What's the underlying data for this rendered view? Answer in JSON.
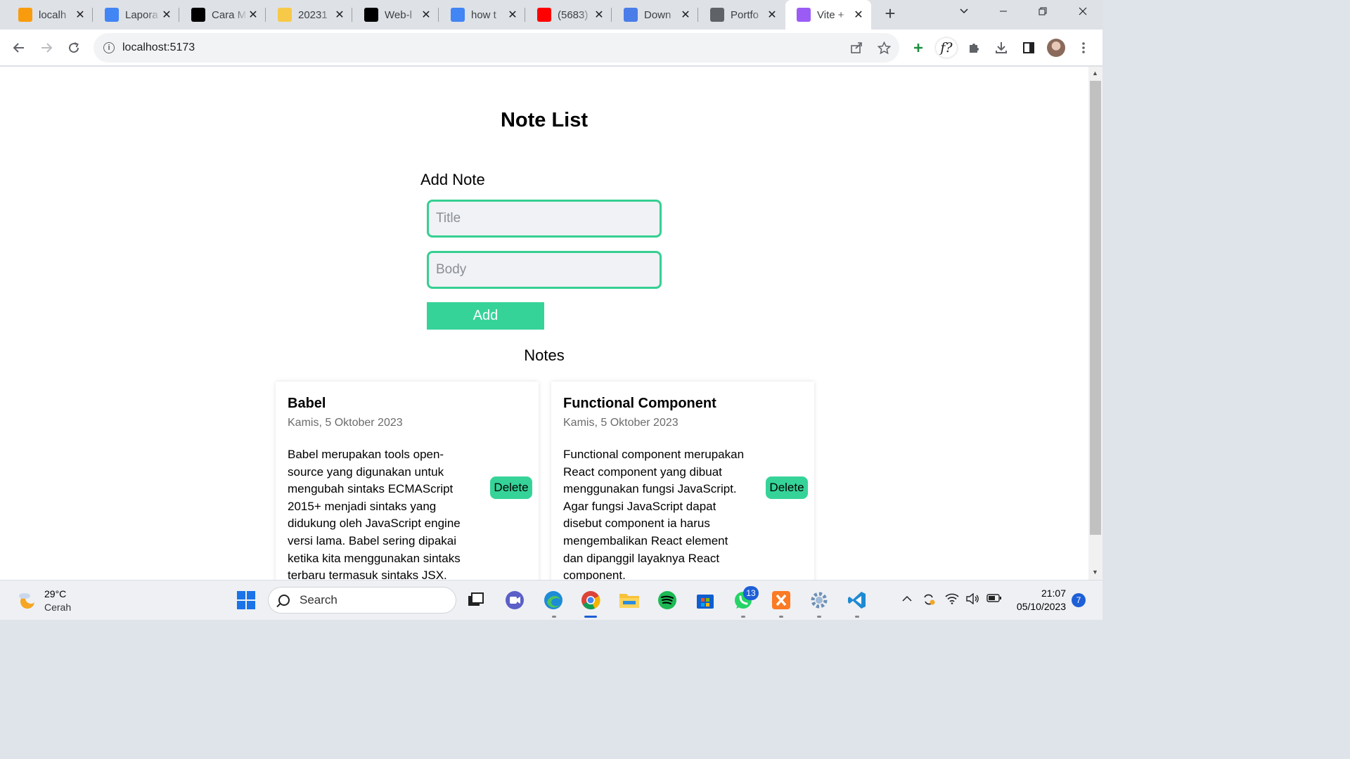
{
  "browser": {
    "tabs": [
      {
        "title": "localh",
        "icon": "phpmyadmin-icon",
        "color": "#f89c0e"
      },
      {
        "title": "Lapora",
        "icon": "google-docs-icon",
        "color": "#4285f4"
      },
      {
        "title": "Cara M",
        "icon": "arrow-logo-icon",
        "color": "#000000"
      },
      {
        "title": "20231",
        "icon": "bulb-icon",
        "color": "#f7c948"
      },
      {
        "title": "Web-l",
        "icon": "github-icon",
        "color": "#000000"
      },
      {
        "title": "how t",
        "icon": "google-icon",
        "color": "#4285f4"
      },
      {
        "title": "(5683)",
        "icon": "youtube-icon",
        "color": "#ff0000"
      },
      {
        "title": "Down",
        "icon": "heart-icon",
        "color": "#4a7de8"
      },
      {
        "title": "Portfo",
        "icon": "globe-icon",
        "color": "#5f6368"
      },
      {
        "title": "Vite +",
        "icon": "vite-icon",
        "color": "#9b5cf6"
      }
    ],
    "active_tab": 9,
    "url": "localhost:5173"
  },
  "page": {
    "title": "Note List",
    "add_heading": "Add Note",
    "title_placeholder": "Title",
    "body_placeholder": "Body",
    "add_label": "Add",
    "notes_heading": "Notes",
    "notes": [
      {
        "title": "Babel",
        "date": "Kamis, 5 Oktober 2023",
        "body": "Babel merupakan tools open-source yang digunakan untuk mengubah sintaks ECMAScript 2015+ menjadi sintaks yang didukung oleh JavaScript engine versi lama. Babel sering dipakai ketika kita menggunakan sintaks terbaru termasuk sintaks JSX.",
        "delete_label": "Delete"
      },
      {
        "title": "Functional Component",
        "date": "Kamis, 5 Oktober 2023",
        "body": "Functional component merupakan React component yang dibuat menggunakan fungsi JavaScript. Agar fungsi JavaScript dapat disebut component ia harus mengembalikan React element dan dipanggil layaknya React component.",
        "delete_label": "Delete"
      }
    ],
    "accent_color": "#36d399"
  },
  "taskbar": {
    "weather_temp": "29°C",
    "weather_condition": "Cerah",
    "search_label": "Search",
    "whatsapp_badge": "13",
    "time": "21:07",
    "date": "05/10/2023",
    "notification_count": "7"
  }
}
